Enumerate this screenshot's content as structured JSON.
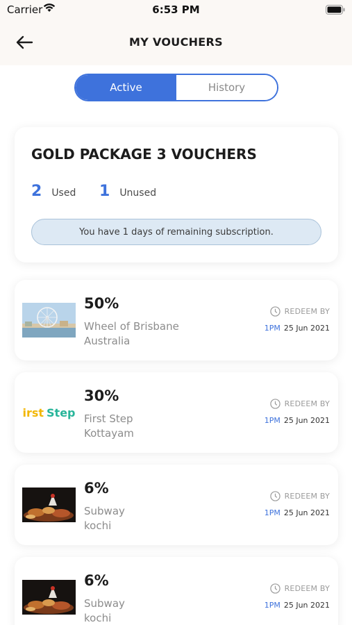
{
  "status": {
    "carrier": "Carrier",
    "time": "6:53 PM"
  },
  "header": {
    "title": "MY VOUCHERS"
  },
  "tabs": [
    {
      "label": "Active"
    },
    {
      "label": "History"
    }
  ],
  "summary": {
    "title": "GOLD PACKAGE 3 VOUCHERS",
    "used_count": "2",
    "used_label": "Used",
    "unused_count": "1",
    "unused_label": "Unused",
    "subscription_text": "You have 1 days of remaining subscription."
  },
  "vouchers": [
    {
      "percent": "50%",
      "name_line1": "Wheel of Brisbane",
      "name_line2": "Australia",
      "redeem_label": "REDEEM BY",
      "time": "1PM",
      "date": "25 Jun 2021",
      "image": "ferris-wheel"
    },
    {
      "percent": "30%",
      "name_line1": "First Step",
      "name_line2": "Kottayam",
      "redeem_label": "REDEEM BY",
      "time": "1PM",
      "date": "25 Jun 2021",
      "image": "first-step-logo",
      "logo_text_1": "irst",
      "logo_text_2": "Step"
    },
    {
      "percent": "6%",
      "name_line1": "Subway",
      "name_line2": "kochi",
      "redeem_label": "REDEEM BY",
      "time": "1PM",
      "date": "25 Jun 2021",
      "image": "food-dish"
    },
    {
      "percent": "6%",
      "name_line1": "Subway",
      "name_line2": "kochi",
      "redeem_label": "REDEEM BY",
      "time": "1PM",
      "date": "25 Jun 2021",
      "image": "food-dish"
    }
  ],
  "colors": {
    "accent": "#3e72dc",
    "header_bg": "#fbf8f5",
    "pill_bg": "#dde9f4"
  }
}
